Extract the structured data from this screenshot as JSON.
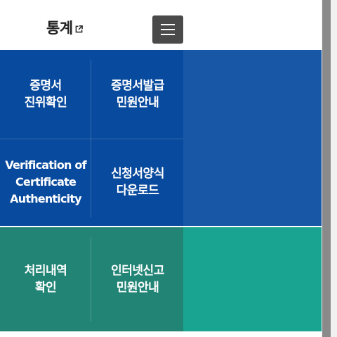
{
  "header": {
    "stats_label": "통계",
    "external_icon": "external-link-icon",
    "menu_icon": "hamburger-menu-icon"
  },
  "services": {
    "blue": [
      {
        "label": "증명서\n진위확인"
      },
      {
        "label": "증명서발급\n민원안내"
      },
      {
        "label": "Verification of\nCertificate\nAuthenticity"
      },
      {
        "label": "신청서양식\n다운로드"
      }
    ],
    "green": [
      {
        "label": "처리내역\n확인"
      },
      {
        "label": "인터넷신고\n민원안내"
      }
    ]
  },
  "colors": {
    "blue_panel": "#1856a6",
    "blue_grid": "#084a9d",
    "green_panel": "#19a391",
    "green_grid": "#228475",
    "menu_button": "#4a4a4a"
  }
}
